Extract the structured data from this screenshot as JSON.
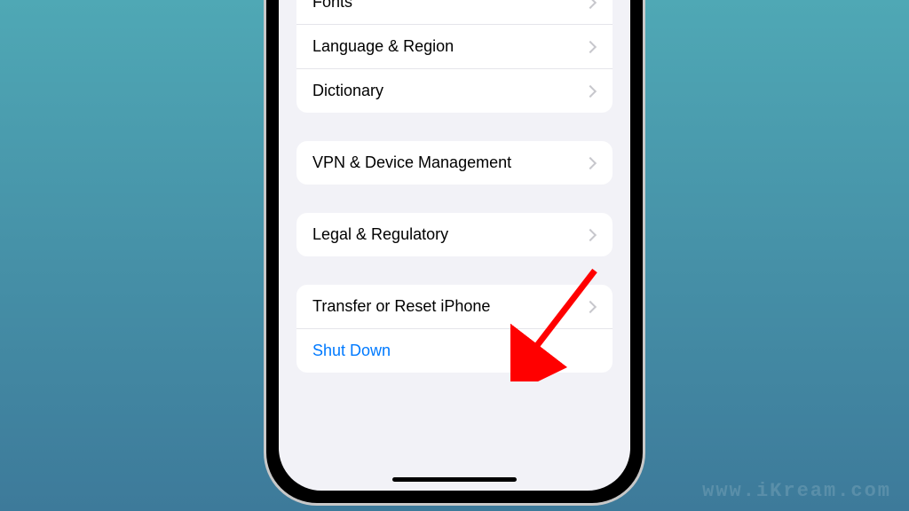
{
  "groups": {
    "general": [
      {
        "label": "Fonts",
        "chevron": true,
        "name": "settings-row-fonts"
      },
      {
        "label": "Language & Region",
        "chevron": true,
        "name": "settings-row-language-region"
      },
      {
        "label": "Dictionary",
        "chevron": true,
        "name": "settings-row-dictionary"
      }
    ],
    "device": [
      {
        "label": "VPN & Device Management",
        "chevron": true,
        "name": "settings-row-vpn-device"
      }
    ],
    "legal": [
      {
        "label": "Legal & Regulatory",
        "chevron": true,
        "name": "settings-row-legal"
      }
    ],
    "reset": [
      {
        "label": "Transfer or Reset iPhone",
        "chevron": true,
        "name": "settings-row-transfer-reset"
      },
      {
        "label": "Shut Down",
        "chevron": false,
        "name": "settings-row-shutdown",
        "action": true
      }
    ]
  },
  "watermark": "www.iKream.com",
  "colors": {
    "link": "#007aff",
    "chevron": "#c7c7cc",
    "background": "#f2f2f7",
    "arrow": "#ff0000"
  }
}
